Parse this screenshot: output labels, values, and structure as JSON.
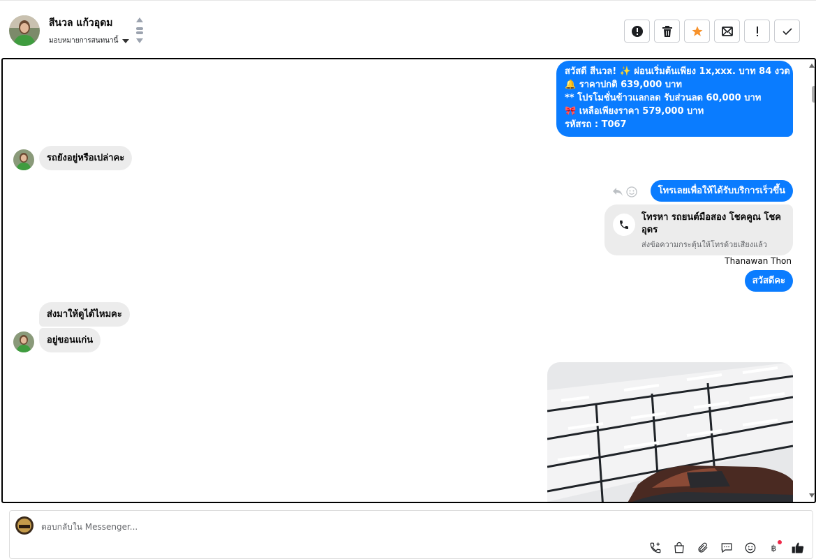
{
  "header": {
    "contact_name": "สีนวล แก้วอุดม",
    "assign_label": "มอบหมายการสนทนานี้",
    "toolbar": [
      {
        "name": "spam-button",
        "icon": "alert-circle-icon"
      },
      {
        "name": "delete-button",
        "icon": "trash-icon"
      },
      {
        "name": "star-button",
        "icon": "star-icon"
      },
      {
        "name": "mark-unread-button",
        "icon": "envelope-x-icon"
      },
      {
        "name": "follow-up-button",
        "icon": "exclamation-icon"
      },
      {
        "name": "done-button",
        "icon": "check-icon"
      }
    ]
  },
  "messages": {
    "promo": {
      "line1": "สวัสดี สีนวล! ✨  ผ่อนเริ่มต้นเพียง 1x,xxx. บาท 84 งวด",
      "line2": "🔔 ราคาปกติ 639,000 บาท",
      "line3": "** โปรโมชั่นข้าวแลกลด รับส่วนลด 60,000 บาท",
      "line4": "🎀  เหลือเพียงราคา 579,000 บาท",
      "line5": " รหัสรถ : T067"
    },
    "in1": "รถยังอยู่หรือเปล่าคะ",
    "out_call": "โทรเลยเพื่อให้ได้รับบริการเร็วขึ้น",
    "call_card": {
      "title": "โทรหา รถยนต์มือสอง โชคคูณ โชค อุดร",
      "subtitle": "ส่งข้อความกระตุ้นให้โทรด้วยเสียงแล้ว"
    },
    "sender_name": "Thanawan Thon",
    "out_hello": "สวัสดีคะ",
    "in2": "ส่งมาให้ดูได้ไหมคะ",
    "in3": "อยู่ขอนแก่น"
  },
  "composer": {
    "placeholder": "ตอบกลับใน Messenger..."
  },
  "colors": {
    "outgoing_bubble": "#0a7cff",
    "incoming_bubble": "#ececec",
    "star": "#f7922b"
  }
}
